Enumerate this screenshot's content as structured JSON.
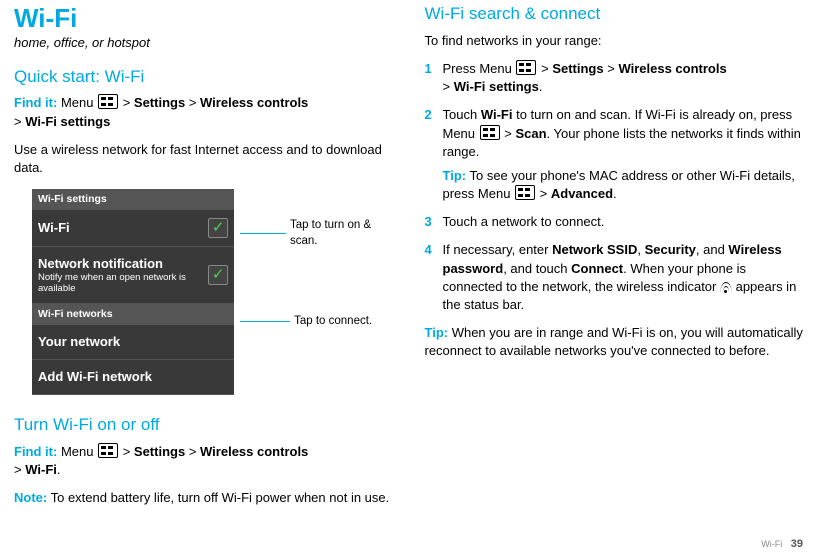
{
  "left": {
    "title": "Wi-Fi",
    "tagline": "home, office, or hotspot",
    "quick_start_heading": "Quick start: Wi-Fi",
    "find_it_label": "Find it:",
    "menu_text": " Menu ",
    "path1a": "Settings",
    "path1b": "Wireless controls",
    "path1c": "Wi-Fi settings",
    "intro": "Use a wireless network for fast Internet access and to download data.",
    "shot": {
      "hdr": "Wi-Fi settings",
      "row1": "Wi-Fi",
      "row2_title": "Network notification",
      "row2_sub": "Notify me when an open network is available",
      "sub": "Wi-Fi networks",
      "row3": "Your network",
      "row4": "Add Wi-Fi network"
    },
    "callout1": "Tap to turn on & scan.",
    "callout2": "Tap to connect.",
    "turn_heading": "Turn Wi-Fi on or off",
    "find_it_label2": "Find it:",
    "path2c": "Wi-Fi",
    "note_label": "Note:",
    "note_text": " To extend battery life, turn off Wi-Fi power when not in use."
  },
  "right": {
    "heading": "Wi-Fi search & connect",
    "intro": "To find networks in your range:",
    "step1a": "Press Menu ",
    "step1b": "Settings",
    "step1c": "Wireless controls",
    "step1d": "Wi-Fi settings",
    "step2a": "Touch ",
    "step2b": "Wi-Fi",
    "step2c": " to turn on and scan. If Wi-Fi is already on, press Menu ",
    "step2d": "Scan",
    "step2e": ". Your phone lists the networks it finds within range.",
    "tip_label": "Tip:",
    "tip2": " To see your phone's MAC address or other Wi-Fi details, press Menu ",
    "tip2b": "Advanced",
    "step3": "Touch a network to connect.",
    "step4a": "If necessary, enter ",
    "step4b": "Network SSID",
    "step4c": "Security",
    "step4d": "Wireless password",
    "step4e": ", and touch ",
    "step4f": "Connect",
    "step4g": ". When your phone is connected to the network, the wireless indicator ",
    "step4h": " appears in the status bar.",
    "bottom_tip": " When you are in range and Wi-Fi is on, you will automatically reconnect to available networks you've connected to before."
  },
  "gt": " > ",
  "comma_sp": ", ",
  "and_sp": ", and ",
  "period": ".",
  "footer_section": "Wi-Fi",
  "footer_page": "39"
}
